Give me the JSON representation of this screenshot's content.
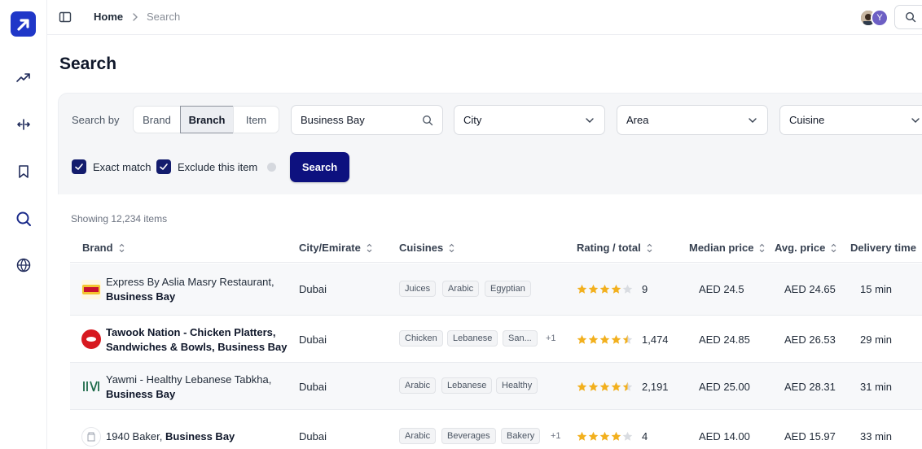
{
  "breadcrumb": {
    "home": "Home",
    "current": "Search"
  },
  "user": {
    "avatar_initial": "Y"
  },
  "page_title": "Search",
  "filters": {
    "search_by_label": "Search by",
    "segments": [
      "Brand",
      "Branch",
      "Item"
    ],
    "active_segment": "Branch",
    "search_value": "Business Bay",
    "city_placeholder": "City",
    "area_placeholder": "Area",
    "cuisine_placeholder": "Cuisine",
    "exact_match_label": "Exact match",
    "exclude_item_label": "Exclude this item",
    "search_button": "Search"
  },
  "results": {
    "showing_text": "Showing 12,234 items",
    "columns": [
      "Brand",
      "City/Emirate",
      "Cuisines",
      "Rating / total",
      "Median price",
      "Avg. price",
      "Delivery time"
    ],
    "rows": [
      {
        "brand_line1": "Express By Aslia Masry Restaurant,",
        "brand_line2": "Business Bay",
        "city": "Dubai",
        "tags": [
          "Juices",
          "Arabic",
          "Egyptian"
        ],
        "more": "",
        "rating": 4,
        "total": "9",
        "median": "AED 24.5",
        "avg": "AED 24.65",
        "delivery": "15 min"
      },
      {
        "brand_line1": "Tawook Nation - Chicken Platters,",
        "brand_line2": "Sandwiches & Bowls, Business Bay",
        "city": "Dubai",
        "tags": [
          "Chicken",
          "Lebanese",
          "San..."
        ],
        "more": "+1",
        "rating": 4.5,
        "total": "1,474",
        "median": "AED 24.85",
        "avg": "AED 26.53",
        "delivery": "29 min"
      },
      {
        "brand_line1": "Yawmi - Healthy Lebanese Tabkha,",
        "brand_line2": "Business Bay",
        "city": "Dubai",
        "tags": [
          "Arabic",
          "Lebanese",
          "Healthy"
        ],
        "more": "",
        "rating": 4.5,
        "total": "2,191",
        "median": "AED 25.00",
        "avg": "AED 28.31",
        "delivery": "31 min"
      },
      {
        "brand_line1": "1940 Baker,",
        "brand_line2": "Business Bay",
        "city": "Dubai",
        "tags": [
          "Arabic",
          "Beverages",
          "Bakery"
        ],
        "more": "+1",
        "rating": 4,
        "total": "4",
        "median": "AED 14.00",
        "avg": "AED 15.97",
        "delivery": "33 min"
      }
    ]
  },
  "colors": {
    "primary": "#0d117f",
    "logo": "#1f37c8",
    "star": "#f2b01e",
    "star_empty": "#d9dce1"
  }
}
